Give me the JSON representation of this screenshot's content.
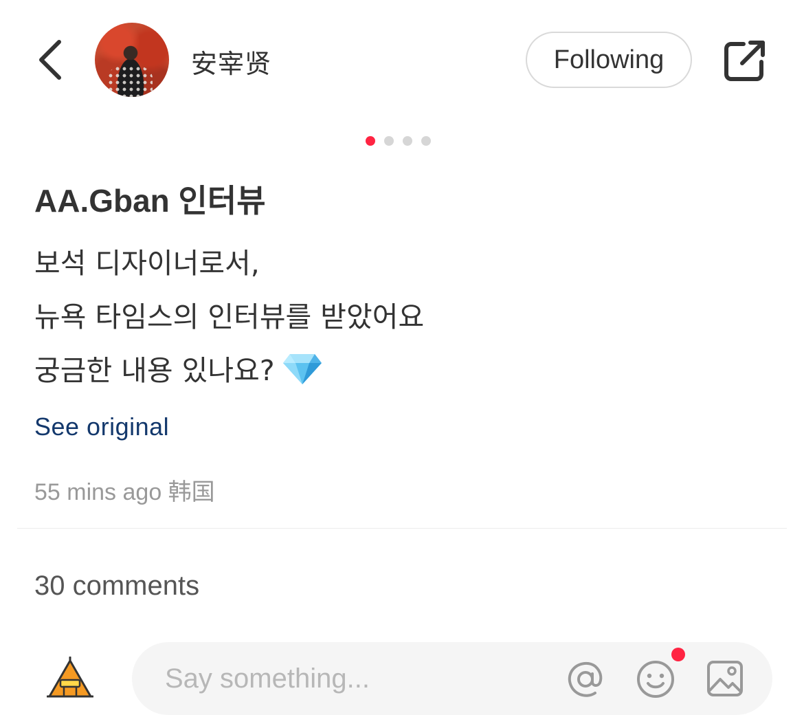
{
  "header": {
    "username": "安宰贤",
    "follow_label": "Following"
  },
  "carousel": {
    "total": 4,
    "active_index": 0,
    "active_color": "#ff2442"
  },
  "post": {
    "title": "AA.Gban 인터뷰",
    "lines": [
      "보석 디자이너로서,",
      "뉴욕 타임스의 인터뷰를 받았어요",
      "궁금한 내용 있나요?"
    ],
    "line_emoji": "gem-stone-icon",
    "see_original": "See original",
    "meta": "55 mins ago 韩国"
  },
  "comments": {
    "count_label": "30 comments"
  },
  "comment_bar": {
    "placeholder": "Say something...",
    "icons": [
      "tent-avatar-icon",
      "at-icon",
      "emoji-icon",
      "image-icon"
    ]
  },
  "colors": {
    "accent": "#ff2442",
    "link": "#13386c",
    "text": "#333333",
    "muted": "#999999"
  }
}
